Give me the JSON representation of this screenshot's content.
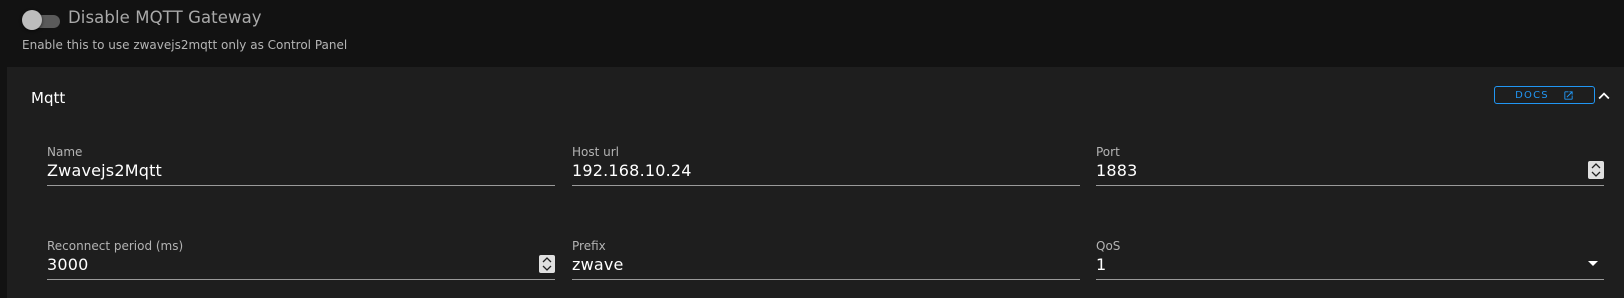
{
  "gateway": {
    "toggle_label": "Disable MQTT Gateway",
    "toggle_hint": "Enable this to use zwavejs2mqtt only as Control Panel",
    "toggle_on": false
  },
  "panel": {
    "title": "Mqtt",
    "docs_label": "DOCS"
  },
  "fields": {
    "name": {
      "label": "Name",
      "value": "Zwavejs2Mqtt"
    },
    "host": {
      "label": "Host url",
      "value": "192.168.10.24"
    },
    "port": {
      "label": "Port",
      "value": "1883"
    },
    "reconnect": {
      "label": "Reconnect period (ms)",
      "value": "3000"
    },
    "prefix": {
      "label": "Prefix",
      "value": "zwave"
    },
    "qos": {
      "label": "QoS",
      "value": "1"
    }
  },
  "colors": {
    "accent": "#2196f3",
    "background": "#121212",
    "panel": "#1e1e1e"
  }
}
